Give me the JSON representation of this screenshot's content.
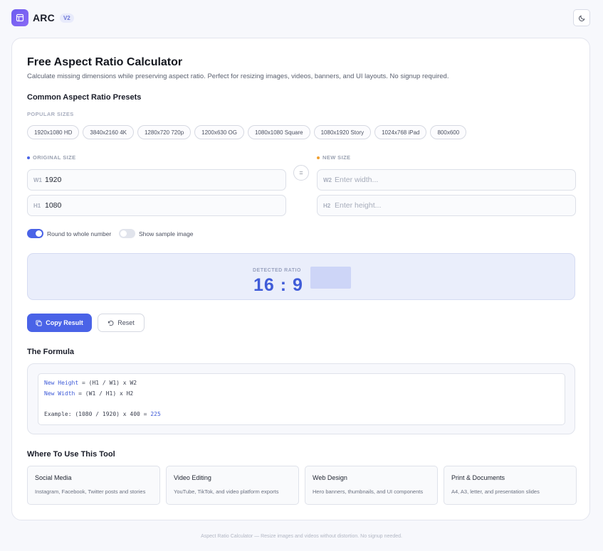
{
  "app": {
    "name": "ARC",
    "version": "V2"
  },
  "page": {
    "title": "Free Aspect Ratio Calculator",
    "subtitle": "Calculate missing dimensions while preserving aspect ratio. Perfect for resizing images, videos, banners, and UI layouts. No signup required."
  },
  "presets": {
    "heading": "Common Aspect Ratio Presets",
    "label": "POPULAR SIZES",
    "items": [
      "1920x1080 HD",
      "3840x2160 4K",
      "1280x720 720p",
      "1200x630 OG",
      "1080x1080 Square",
      "1080x1920 Story",
      "1024x768 iPad",
      "800x600"
    ]
  },
  "original": {
    "label": "ORIGINAL SIZE",
    "w_label": "W1",
    "h_label": "H1",
    "w_value": "1920",
    "h_value": "1080"
  },
  "equals": "=",
  "new_size": {
    "label": "NEW SIZE",
    "w_label": "W2",
    "h_label": "H2",
    "w_placeholder": "Enter width...",
    "h_placeholder": "Enter height..."
  },
  "toggles": {
    "round_label": "Round to whole number",
    "round_on": true,
    "sample_label": "Show sample image",
    "sample_on": false
  },
  "ratio": {
    "label": "DETECTED RATIO",
    "value": "16 : 9"
  },
  "actions": {
    "copy_label": "Copy Result",
    "reset_label": "Reset"
  },
  "formula": {
    "heading": "The Formula",
    "line1_var": "New Height",
    "line1_rest": " = (H1 / W1) x W2",
    "line2_var": "New Width",
    "line2_rest": " = (W1 / H1) x H2",
    "example_text": "Example: (1080 / 1920) x 400 = ",
    "example_result": "225"
  },
  "uses": {
    "heading": "Where To Use This Tool",
    "items": [
      {
        "title": "Social Media",
        "desc": "Instagram, Facebook, Twitter posts and stories"
      },
      {
        "title": "Video Editing",
        "desc": "YouTube, TikTok, and video platform exports"
      },
      {
        "title": "Web Design",
        "desc": "Hero banners, thumbnails, and UI components"
      },
      {
        "title": "Print & Documents",
        "desc": "A4, A3, letter, and presentation slides"
      }
    ]
  },
  "footer": "Aspect Ratio Calculator — Resize images and videos without distortion. No signup needed.",
  "colors": {
    "accent": "#4a63e7",
    "new_dot": "#f0a030",
    "orig_dot": "#4a63e7"
  },
  "icons": {
    "logo": "layout-icon",
    "theme": "moon-icon",
    "copy": "copy-icon",
    "reset": "rotate-ccw-icon"
  }
}
